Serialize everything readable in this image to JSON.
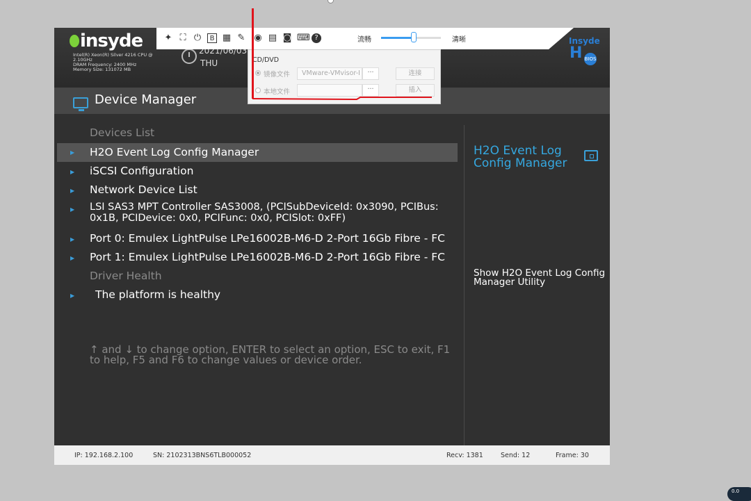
{
  "header": {
    "brand": "insyde",
    "sysinfo": [
      "Intel(R) Xeon(R) Silver 4216 CPU @",
      "2.10GHz",
      "DRAM Frequency: 2400 MHz",
      "Memory Size: 131072 MB"
    ],
    "date": "2021/06/03",
    "day": "THU",
    "h2o_logo_text": "Insyde",
    "h2o_logo_mark": "H",
    "h2o_logo_badge": "BIOS"
  },
  "toolbar": {
    "icons": [
      "pin-icon",
      "fullscreen-icon",
      "power-icon",
      "boot-icon",
      "keyboard-shortcut-icon",
      "mouse-icon",
      "cd-icon",
      "floppy-icon",
      "record-icon",
      "virtual-keyboard-icon",
      "help-icon"
    ],
    "quality_left": "流畅",
    "quality_right": "清晰",
    "quality_value": 0.55
  },
  "title": "Device Manager",
  "menu": {
    "sections": [
      {
        "label": "Devices List",
        "items": [
          {
            "label": "H2O Event Log Config Manager",
            "selected": true
          },
          {
            "label": "iSCSI Configuration"
          },
          {
            "label": "Network Device List"
          },
          {
            "label": "LSI SAS3 MPT Controller SAS3008, (PCISubDeviceId: 0x3090, PCIBus:",
            "label2": "0x1B, PCIDevice: 0x0, PCIFunc: 0x0, PCISlot: 0xFF)"
          },
          {
            "label": "Port 0: Emulex LightPulse LPe16002B-M6-D 2-Port 16Gb Fibre - FC"
          },
          {
            "label": "Port 1: Emulex LightPulse LPe16002B-M6-D 2-Port 16Gb Fibre - FC"
          }
        ]
      },
      {
        "label": "Driver Health",
        "items": [
          {
            "label": "The platform is healthy"
          }
        ]
      }
    ]
  },
  "help_text": "↑ and ↓ to change option, ENTER to select an option, ESC to exit, F1 to help, F5 and F6 to change values or device order.",
  "right_panel": {
    "title": "H2O Event Log Config Manager",
    "description": "Show H2O Event Log Config Manager Utility"
  },
  "status": {
    "ip": "IP: 192.168.2.100",
    "sn": "SN: 2102313BNS6TLB000052",
    "recv": "Recv: 1381",
    "send": "Send: 12",
    "frame": "Frame: 30"
  },
  "cd_popup": {
    "title": "CD/DVD",
    "image_option": "镜像文件",
    "image_value": "VMware-VMvisor-I",
    "local_option": "本地文件",
    "local_value": "",
    "dots": "···",
    "connect": "连接",
    "insert": "插入"
  },
  "overlay": {
    "partial_text": "连接",
    "badge": "0.0"
  }
}
